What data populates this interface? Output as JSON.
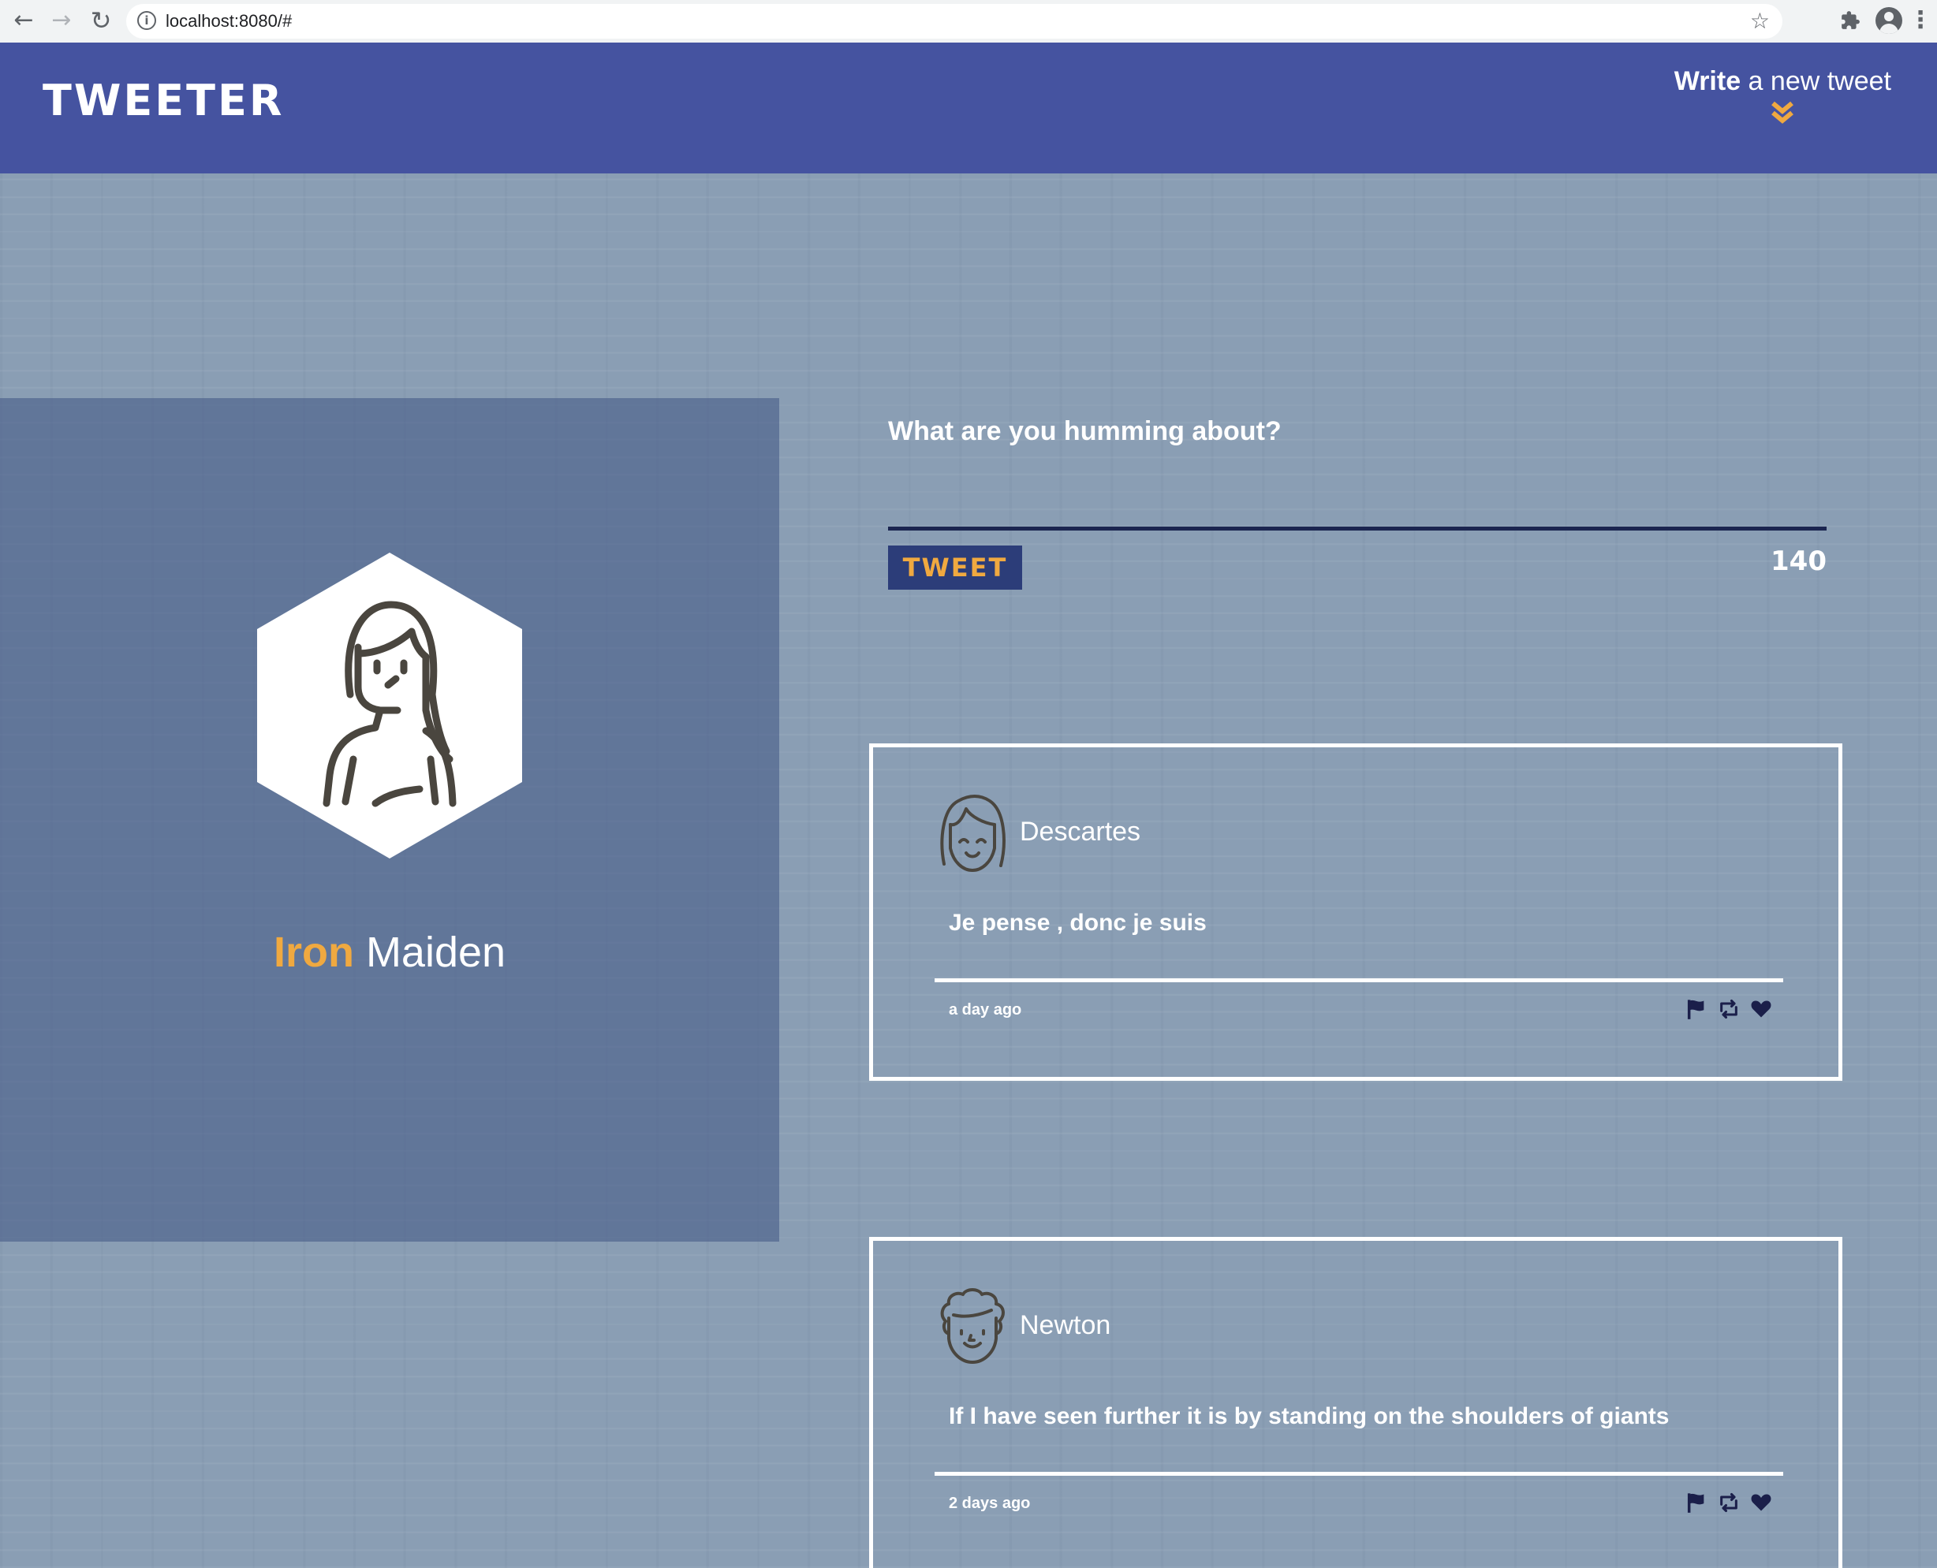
{
  "browser": {
    "url": "localhost:8080/#",
    "icons": [
      "back-arrow-icon",
      "forward-arrow-icon",
      "reload-icon",
      "info-icon",
      "bookmark-star-icon",
      "extensions-icon",
      "profile-icon",
      "kebab-menu-icon"
    ]
  },
  "header": {
    "logo": "TWEETER",
    "compose_toggle": {
      "bold": "Write",
      "rest": " a new tweet"
    },
    "accent_color": "#f0a940",
    "background_color": "#4553a0"
  },
  "profile": {
    "first_name": "Iron",
    "last_name": "Maiden",
    "avatar_icon": "woman-avatar-icon"
  },
  "compose": {
    "prompt": "What are you humming about?",
    "tweet_button": "TWEET",
    "char_counter": "140"
  },
  "tweets": [
    {
      "author": "Descartes",
      "avatar_icon": "girl-avatar-icon",
      "content": "Je pense , donc je suis",
      "time": "a day ago",
      "actions": [
        "flag-icon",
        "retweet-icon",
        "heart-icon"
      ]
    },
    {
      "author": "Newton",
      "avatar_icon": "curly-hair-avatar-icon",
      "content": "If I have seen further it is by standing on the shoulders of giants",
      "time": "2 days ago",
      "actions": [
        "flag-icon",
        "retweet-icon",
        "heart-icon"
      ]
    }
  ]
}
